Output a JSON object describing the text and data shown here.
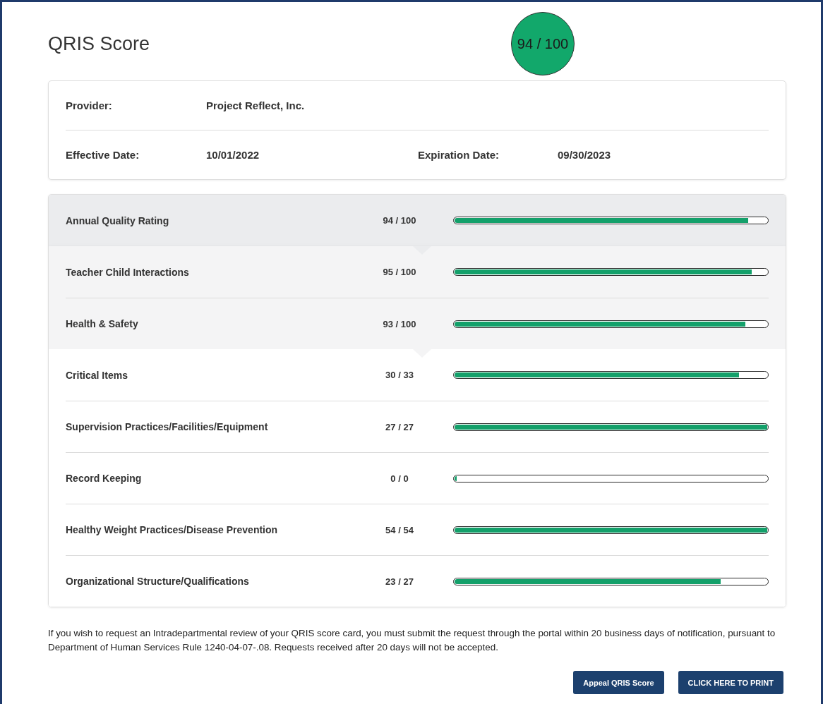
{
  "title": "QRIS Score",
  "overall_score": "94 / 100",
  "info": {
    "rows": [
      [
        {
          "label": "Provider:",
          "value": "Project Reflect, Inc."
        }
      ],
      [
        {
          "label": "Effective Date:",
          "value": "10/01/2022"
        },
        {
          "label": "Expiration Date:",
          "value": "09/30/2023"
        }
      ]
    ]
  },
  "ratings": [
    {
      "name": "Annual Quality Rating",
      "score": "94 / 100",
      "level": 0.94,
      "expanded": true,
      "children": [
        {
          "name": "Teacher Child Interactions",
          "score": "95 / 100",
          "level": 0.95
        },
        {
          "name": "Health & Safety",
          "score": "93 / 100",
          "level": 0.93,
          "expanded": true,
          "children": [
            {
              "name": "Critical Items",
              "score": "30 / 33",
              "level": 0.91
            },
            {
              "name": "Supervision Practices/Facilities/Equipment",
              "score": "27 / 27",
              "level": 1
            },
            {
              "name": "Record Keeping",
              "score": "0 / 0",
              "level": 0
            },
            {
              "name": "Healthy Weight Practices/Disease Prevention",
              "score": "54 / 54",
              "level": 1
            },
            {
              "name": "Organizational Structure/Qualifications",
              "score": "23 / 27",
              "level": 0.85
            }
          ]
        }
      ]
    }
  ],
  "notice": "If you wish to request an Intradepartmental review of your QRIS score card, you must submit the request through the portal within 20 business days of notification, pursuant to Department of Human Services Rule 1240-04-07-.08. Requests received after 20 days will not be accepted.",
  "buttons": [
    {
      "label": "Appeal QRIS Score"
    },
    {
      "label": "CLICK HERE TO PRINT"
    }
  ]
}
